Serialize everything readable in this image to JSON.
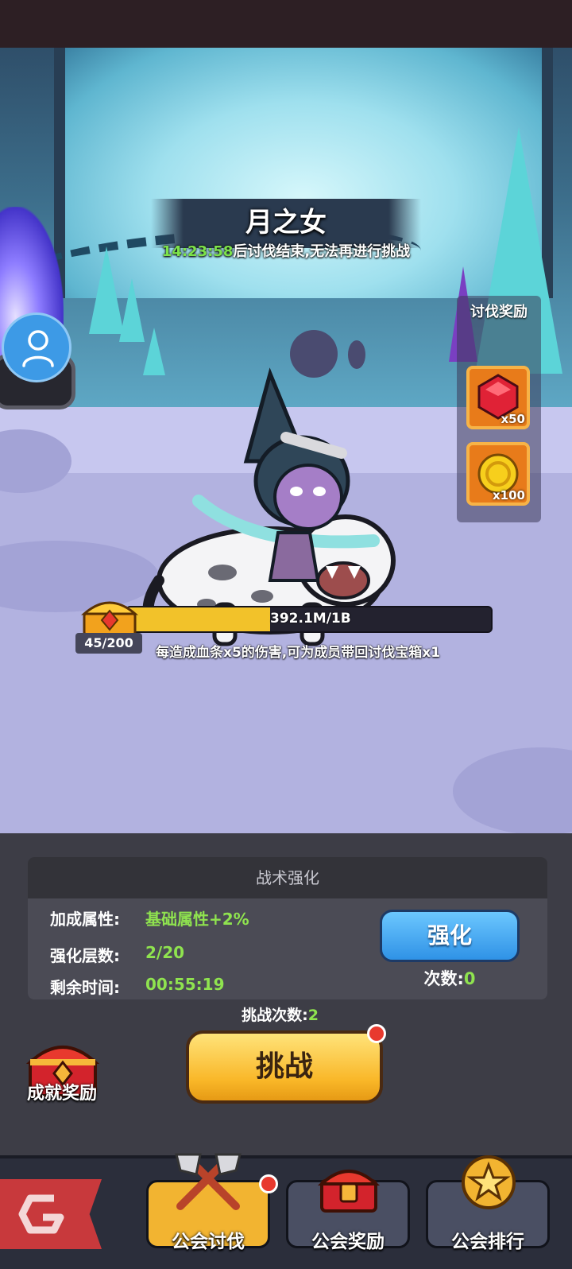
{
  "boss": {
    "name": "月之女",
    "countdown": "14:23:58",
    "countdown_suffix": "后讨伐结束,无法再进行挑战",
    "hp_text": "392.1M/1B",
    "hp_fraction": 0.392,
    "chest_count": "45/200",
    "hint": "每造成血条x5的伤害,可为成员带回讨伐宝箱x1"
  },
  "rewards": {
    "title": "讨伐奖励",
    "items": [
      {
        "icon": "red-gem-icon",
        "qty": "x50"
      },
      {
        "icon": "gold-coin-icon",
        "qty": "x100"
      }
    ]
  },
  "tactics": {
    "title": "战术强化",
    "rows": [
      {
        "label": "加成属性:",
        "value": "基础属性+2%"
      },
      {
        "label": "强化层数:",
        "value": "2/20"
      },
      {
        "label": "剩余时间:",
        "value": "00:55:19"
      }
    ],
    "enhance_label": "强化",
    "enhance_count_label": "次数:",
    "enhance_count_value": "0"
  },
  "challenge": {
    "count_label": "挑战次数:",
    "count_value": "2",
    "button_label": "挑战"
  },
  "achievement": {
    "label": "成就奖励"
  },
  "nav": {
    "tabs": [
      {
        "label": "公会讨伐",
        "active": true
      },
      {
        "label": "公会奖励",
        "active": false
      },
      {
        "label": "公会排行",
        "active": false
      }
    ]
  },
  "colors": {
    "accent_green": "#8fe34f",
    "hp_bar": "#f2c22a",
    "enhance_blue": "#2f92e6",
    "challenge_gold": "#f9b728"
  }
}
